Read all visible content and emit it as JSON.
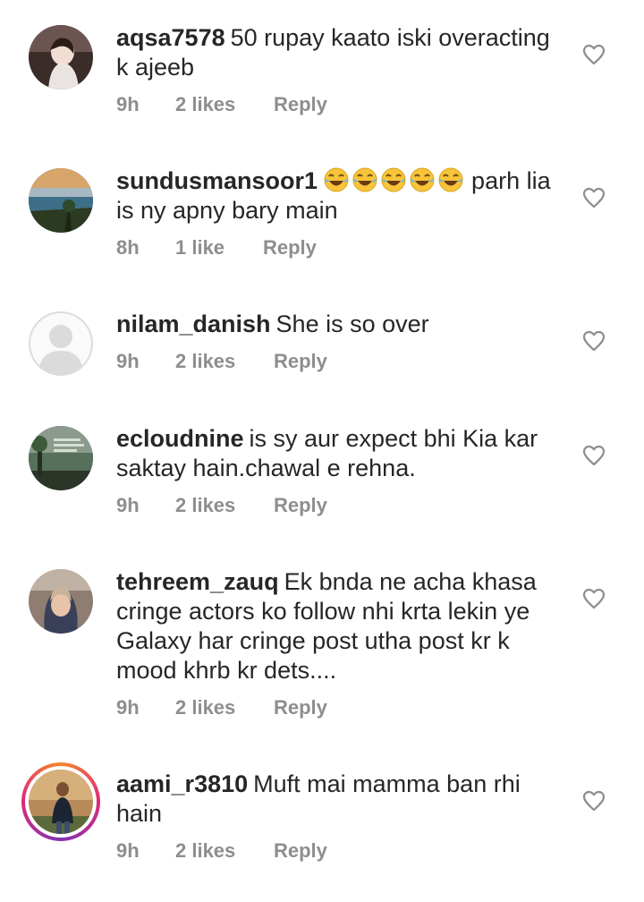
{
  "comments": [
    {
      "username": "aqsa7578",
      "text": "50 rupay kaato iski overacting k ajeeb",
      "time": "9h",
      "likes": "2 likes",
      "reply": "Reply",
      "avatar": "avatar-girl-photo",
      "heart_icon": "heart-outline-icon"
    },
    {
      "username": "sundusmansoor1",
      "emoji": [
        "😂",
        "😂",
        "😂",
        "😂",
        "😂"
      ],
      "text": "parh lia is ny apny bary main",
      "time": "8h",
      "likes": "1 like",
      "reply": "Reply",
      "avatar": "avatar-landscape-photo",
      "heart_icon": "heart-outline-icon"
    },
    {
      "username": "nilam_danish",
      "text": "She is so over",
      "time": "9h",
      "likes": "2 likes",
      "reply": "Reply",
      "avatar": "avatar-default-placeholder",
      "heart_icon": "heart-outline-icon"
    },
    {
      "username": "ecloudnine",
      "text": "is sy aur expect bhi Kia kar saktay hain.chawal e rehna.",
      "time": "9h",
      "likes": "2 likes",
      "reply": "Reply",
      "avatar": "avatar-scenery-photo",
      "heart_icon": "heart-outline-icon"
    },
    {
      "username": "tehreem_zauq",
      "text": "Ek bnda ne acha khasa cringe actors ko follow nhi krta lekin ye Galaxy har cringe post utha post kr k mood khrb kr dets....",
      "time": "9h",
      "likes": "2 likes",
      "reply": "Reply",
      "avatar": "avatar-hijab-photo",
      "heart_icon": "heart-outline-icon"
    },
    {
      "username": "aami_r3810",
      "text": "Muft mai mamma ban rhi hain",
      "time": "9h",
      "likes": "2 likes",
      "reply": "Reply",
      "avatar": "avatar-man-photo-story-ring",
      "heart_icon": "heart-outline-icon"
    }
  ],
  "colors": {
    "text": "#262626",
    "meta": "#8e8e8e",
    "background": "#ffffff"
  }
}
